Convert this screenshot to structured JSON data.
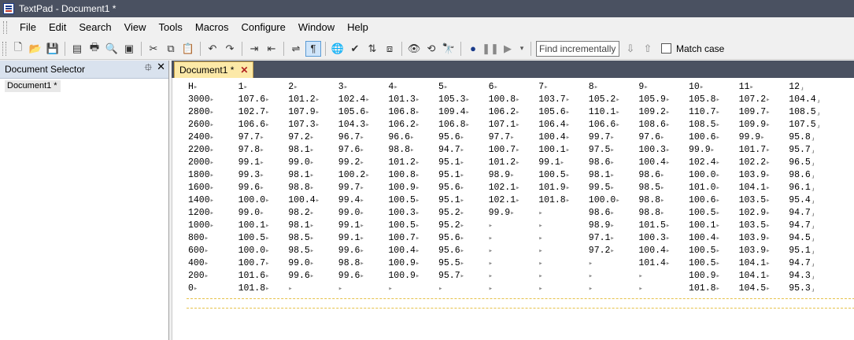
{
  "window": {
    "title": "TextPad - Document1 *"
  },
  "menu": [
    "File",
    "Edit",
    "Search",
    "View",
    "Tools",
    "Macros",
    "Configure",
    "Window",
    "Help"
  ],
  "toolbar": {
    "find_placeholder": "Find incrementally",
    "match_case_label": "Match case",
    "buttons": [
      "new-icon",
      "open-icon",
      "save-icon",
      "save-all-icon",
      "print-icon",
      "print-preview-icon",
      "page-setup-icon",
      "cut-icon",
      "copy-icon",
      "paste-icon",
      "undo-icon",
      "redo-icon",
      "indent-icon",
      "outdent-icon",
      "word-wrap-icon",
      "show-symbols-icon",
      "web-icon",
      "spell-check-icon",
      "sort-icon",
      "compare-icon",
      "view-icon",
      "find-replace-icon",
      "find-files-icon",
      "record-macro-icon",
      "pause-macro-icon",
      "play-macro-icon"
    ]
  },
  "doc_selector": {
    "title": "Document Selector",
    "pin_icon": "⯐",
    "close_icon": "✕",
    "items": [
      "Document1 *"
    ]
  },
  "tab": {
    "label": "Document1 *",
    "close": "✕"
  },
  "marks": {
    "tab": "▸",
    "eol": "⸥"
  },
  "table": {
    "rows": [
      [
        "H",
        "1",
        "2",
        "3",
        "4",
        "5",
        "6",
        "7",
        "8",
        "9",
        "10",
        "11",
        "12"
      ],
      [
        "3000",
        "107.6",
        "101.2",
        "102.4",
        "101.3",
        "105.3",
        "100.8",
        "103.7",
        "105.2",
        "105.9",
        "105.8",
        "107.2",
        "104.4"
      ],
      [
        "2800",
        "102.7",
        "107.9",
        "105.6",
        "106.8",
        "109.4",
        "106.2",
        "105.6",
        "110.1",
        "109.2",
        "110.7",
        "109.7",
        "108.5"
      ],
      [
        "2600",
        "106.6",
        "107.3",
        "104.3",
        "106.2",
        "106.8",
        "107.1",
        "106.4",
        "106.6",
        "108.6",
        "108.5",
        "109.9",
        "107.5"
      ],
      [
        "2400",
        "97.7",
        "97.2",
        "96.7",
        "96.6",
        "95.6",
        "97.7",
        "100.4",
        "99.7",
        "97.6",
        "100.6",
        "99.9",
        "95.8"
      ],
      [
        "2200",
        "97.8",
        "98.1",
        "97.6",
        "98.8",
        "94.7",
        "100.7",
        "100.1",
        "97.5",
        "100.3",
        "99.9",
        "101.7",
        "95.7"
      ],
      [
        "2000",
        "99.1",
        "99.0",
        "99.2",
        "101.2",
        "95.1",
        "101.2",
        "99.1",
        "98.6",
        "100.4",
        "102.4",
        "102.2",
        "96.5"
      ],
      [
        "1800",
        "99.3",
        "98.1",
        "100.2",
        "100.8",
        "95.1",
        "98.9",
        "100.5",
        "98.1",
        "98.6",
        "100.0",
        "103.9",
        "98.6"
      ],
      [
        "1600",
        "99.6",
        "98.8",
        "99.7",
        "100.9",
        "95.6",
        "102.1",
        "101.9",
        "99.5",
        "98.5",
        "101.0",
        "104.1",
        "96.1"
      ],
      [
        "1400",
        "100.0",
        "100.4",
        "99.4",
        "100.5",
        "95.1",
        "102.1",
        "101.8",
        "100.0",
        "98.8",
        "100.6",
        "103.5",
        "95.4"
      ],
      [
        "1200",
        "99.0",
        "98.2",
        "99.0",
        "100.3",
        "95.2",
        "99.9",
        "",
        "98.6",
        "98.8",
        "100.5",
        "102.9",
        "94.7"
      ],
      [
        "1000",
        "100.1",
        "98.1",
        "99.1",
        "100.5",
        "95.2",
        "",
        "",
        "98.9",
        "101.5",
        "100.1",
        "103.5",
        "94.7"
      ],
      [
        "800",
        "100.5",
        "98.5",
        "99.1",
        "100.7",
        "95.6",
        "",
        "",
        "97.1",
        "100.3",
        "100.4",
        "103.9",
        "94.5"
      ],
      [
        "600",
        "100.0",
        "98.5",
        "99.6",
        "100.4",
        "95.6",
        "",
        "",
        "97.2",
        "100.4",
        "100.5",
        "103.9",
        "95.1"
      ],
      [
        "400",
        "100.7",
        "99.0",
        "98.8",
        "100.9",
        "95.5",
        "",
        "",
        "",
        "101.4",
        "100.5",
        "104.1",
        "94.7"
      ],
      [
        "200",
        "101.6",
        "99.6",
        "99.6",
        "100.9",
        "95.7",
        "",
        "",
        "",
        "",
        "100.9",
        "104.1",
        "94.3"
      ],
      [
        "0",
        "101.8",
        "",
        "",
        "",
        "",
        "",
        "",
        "",
        "",
        "101.8",
        "104.5",
        "95.3"
      ]
    ]
  }
}
